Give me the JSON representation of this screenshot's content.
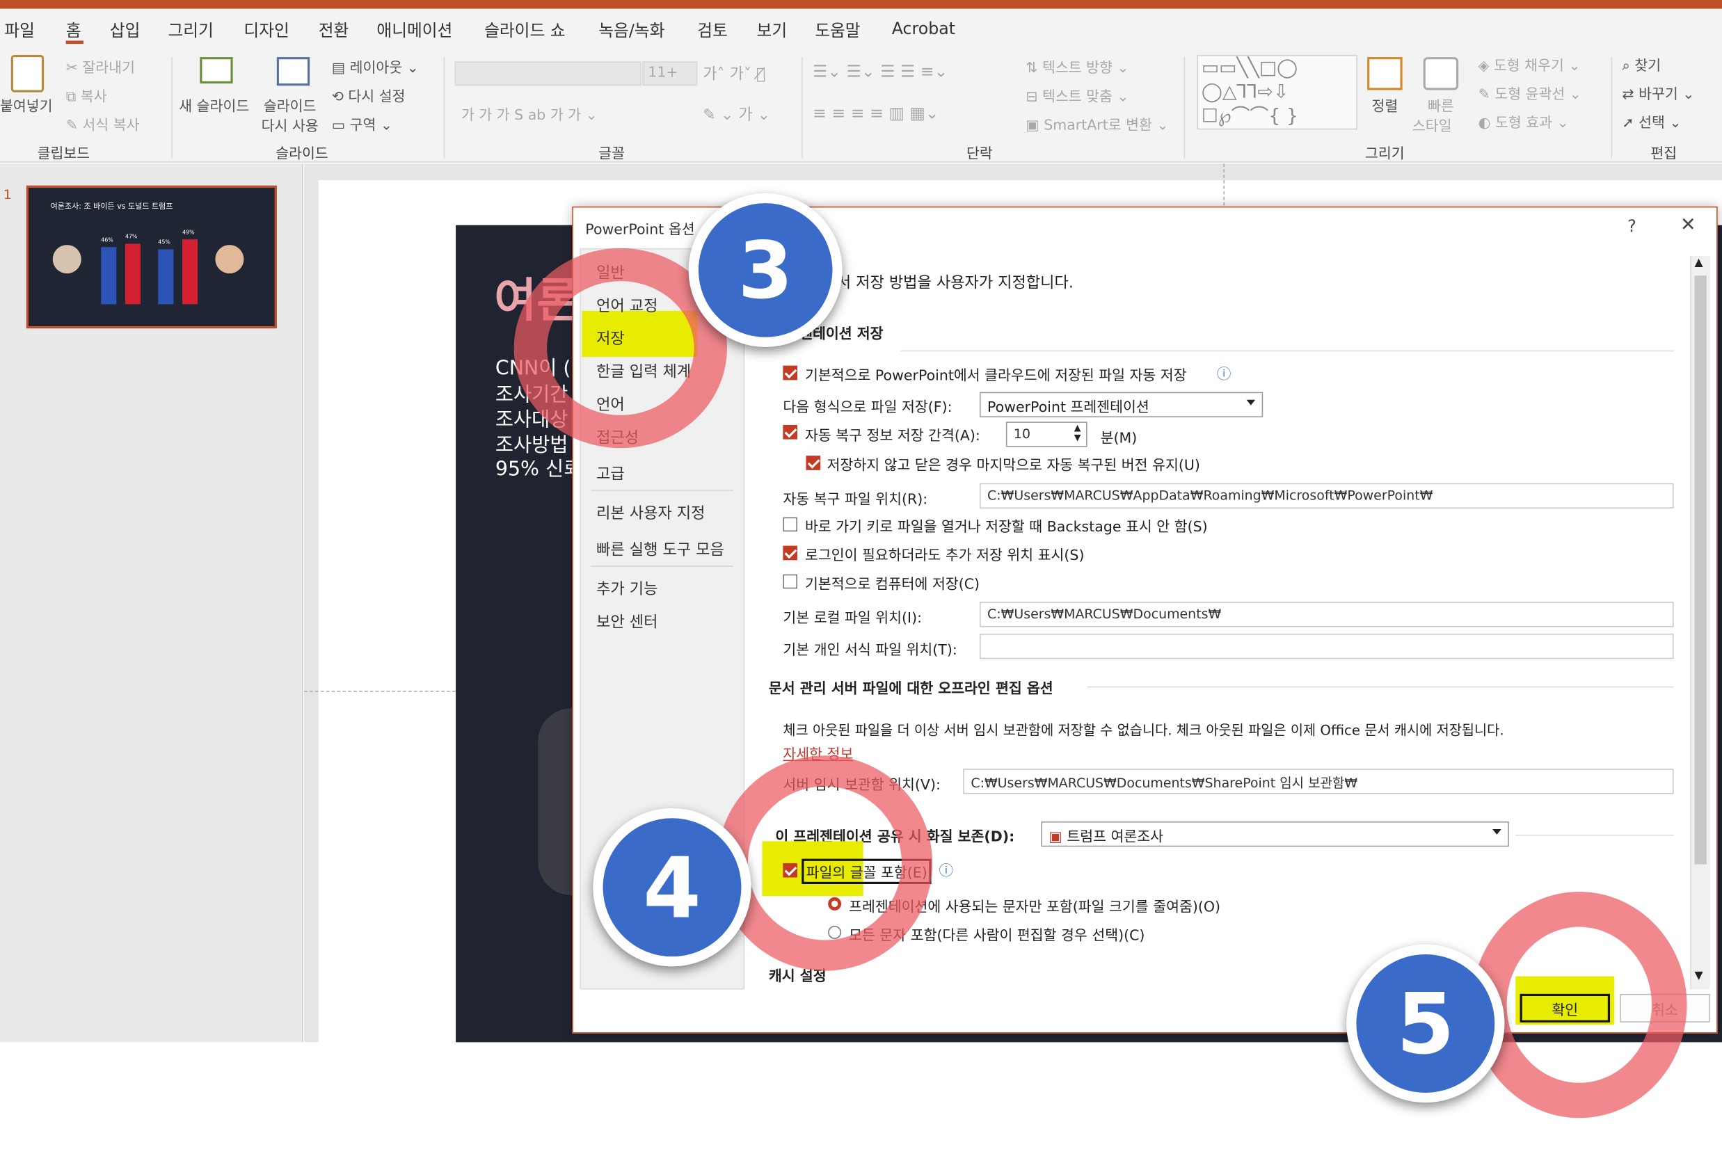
{
  "ribbon_tabs": [
    "파일",
    "홈",
    "삽입",
    "그리기",
    "디자인",
    "전환",
    "애니메이션",
    "슬라이드 쇼",
    "녹음/녹화",
    "검토",
    "보기",
    "도움말",
    "Acrobat"
  ],
  "clipboard": {
    "paste": "붙여넣기",
    "cut": "잘라내기",
    "copy": "복사",
    "format_painter": "서식 복사",
    "group": "클립보드"
  },
  "slides_group": {
    "new_slide": "새 슬라이드",
    "reuse": "슬라이드",
    "reuse2": "다시 사용",
    "layout": "레이아웃",
    "reset": "다시 설정",
    "section": "구역",
    "group": "슬라이드"
  },
  "font_group": {
    "size": "11+",
    "group": "글꼴"
  },
  "paragraph_group": {
    "text_direction": "텍스트 방향",
    "align_text": "텍스트 맞춤",
    "smartart": "SmartArt로 변환",
    "group": "단락"
  },
  "drawing_group": {
    "arrange": "정렬",
    "quick_styles": "빠른",
    "quick_styles2": "스타일",
    "fill": "도형 채우기",
    "outline": "도형 윤곽선",
    "effects": "도형 효과",
    "group": "그리기"
  },
  "editing_group": {
    "find": "찾기",
    "replace": "바꾸기",
    "select": "선택",
    "group": "편집"
  },
  "slide_number": "1",
  "thumbnail": {
    "title": "여론조사: 조 바이든 vs 도널드 트럼프",
    "v1": "46%",
    "v2": "47%",
    "v3": "45%",
    "v4": "49%"
  },
  "slide": {
    "heading": "여론",
    "line1": "CNN이 (",
    "line2": "조사기간",
    "line3": "조사대상",
    "line4": "조사방법",
    "line5": "95% 신뢰"
  },
  "dialog": {
    "title": "PowerPoint 옵션",
    "help": "?",
    "close": "✕",
    "nav": [
      "일반",
      "언어 교정",
      "저장",
      "한글 입력 체계",
      "언어",
      "접근성",
      "고급",
      "리본 사용자 지정",
      "빠른 실행 도구 모음",
      "추가 기능",
      "보안 센터"
    ],
    "intro": "서 저장 방법을 사용자가 지정합니다.",
    "sec_save": "젠테이션 저장",
    "autosave": "기본적으로 PowerPoint에서 클라우드에 저장된 파일 자동 저장",
    "format_label": "다음 형식으로 파일 저장(F):",
    "format_value": "PowerPoint 프레젠테이션",
    "autorecover_label": "자동 복구 정보 저장 간격(A):",
    "autorecover_value": "10",
    "minutes": "분(M)",
    "keep_last": "저장하지 않고 닫은 경우 마지막으로 자동 복구된 버전 유지(U)",
    "ar_loc_label": "자동 복구 파일 위치(R):",
    "ar_loc_value": "C:₩Users₩MARCUS₩AppData₩Roaming₩Microsoft₩PowerPoint₩",
    "no_backstage": "바로 가기 키로 파일을 열거나 저장할 때 Backstage 표시 안 함(S)",
    "show_extra": "로그인이 필요하더라도 추가 저장 위치 표시(S)",
    "save_computer": "기본적으로 컴퓨터에 저장(C)",
    "local_label": "기본 로컬 파일 위치(I):",
    "local_value": "C:₩Users₩MARCUS₩Documents₩",
    "template_label": "기본 개인 서식 파일 위치(T):",
    "template_value": "",
    "sec_offline": "문서 관리 서버 파일에 대한 오프라인 편집 옵션",
    "offline_desc": "체크 아웃된 파일을 더 이상 서버 임시 보관함에 저장할 수 없습니다. 체크 아웃된 파일은 이제 Office 문서 캐시에 저장됩니다.",
    "more_info": "자세한 정보",
    "drafts_label": "서버 임시 보관함 위치(V):",
    "drafts_value": "C:₩Users₩MARCUS₩Documents₩SharePoint 임시 보관함₩",
    "fidelity_label": "이 프레젠테이션 공유 시 화질 보존(D):",
    "fidelity_value": "트럼프 여론조사",
    "embed_fonts": "파일의 글꼴 포함(E)",
    "embed_used": "프레젠테이션에 사용되는 문자만 포함(파일 크기를 줄여줌)(O)",
    "embed_all": "모든 문자 포함(다른 사람이 편집할 경우 선택)(C)",
    "sec_cache": "캐시 설정",
    "ok": "확인",
    "cancel": "취소"
  },
  "steps": [
    "3",
    "4",
    "5"
  ],
  "colors": {
    "accent": "#c0502a",
    "badge": "#3b6bc8",
    "ring": "#ec5a62",
    "highlight": "#e8ec00"
  }
}
